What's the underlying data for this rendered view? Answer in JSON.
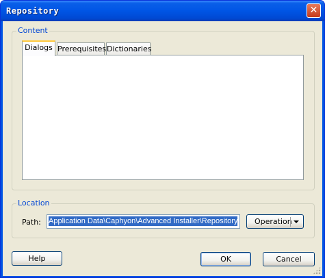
{
  "window": {
    "title": "Repository",
    "close_glyph": "✕"
  },
  "content_group": {
    "label": "Content",
    "tabs": [
      {
        "label": "Dialogs",
        "active": true
      },
      {
        "label": "Prerequisites",
        "active": false
      },
      {
        "label": "Dictionaries",
        "active": false
      }
    ]
  },
  "location_group": {
    "label": "Location",
    "path_label": "Path:",
    "path_value": "Application Data\\Caphyon\\Advanced Installer\\Repository",
    "operation_button": "Operation"
  },
  "footer": {
    "help": "Help",
    "ok": "OK",
    "cancel": "Cancel"
  },
  "colors": {
    "title_bar": "#0055e5",
    "dialog_bg": "#ece9d8",
    "group_label": "#0046d5",
    "selection": "#316ac5"
  }
}
